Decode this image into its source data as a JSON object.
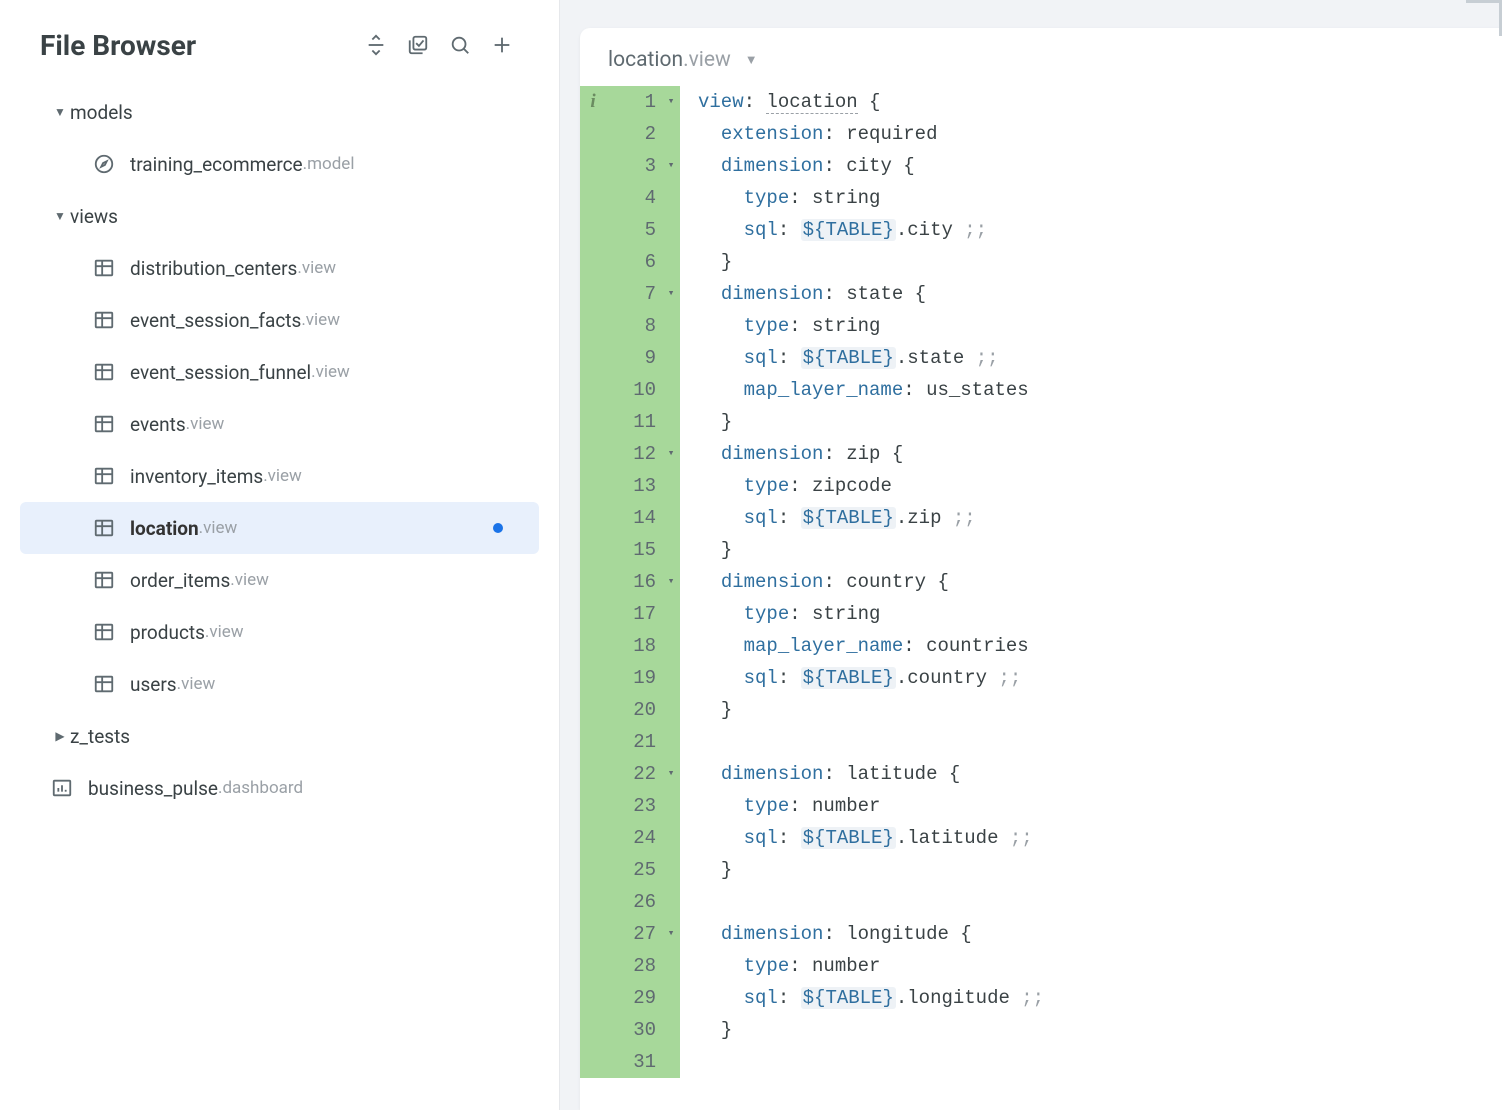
{
  "sidebar": {
    "title": "File Browser",
    "folders": {
      "models": {
        "label": "models",
        "expanded": true
      },
      "views": {
        "label": "views",
        "expanded": true
      },
      "ztests": {
        "label": "z_tests",
        "expanded": false
      }
    },
    "model_files": [
      {
        "name": "training_ecommerce",
        "ext": ".model"
      }
    ],
    "view_files": [
      {
        "name": "distribution_centers",
        "ext": ".view"
      },
      {
        "name": "event_session_facts",
        "ext": ".view"
      },
      {
        "name": "event_session_funnel",
        "ext": ".view"
      },
      {
        "name": "events",
        "ext": ".view"
      },
      {
        "name": "inventory_items",
        "ext": ".view"
      },
      {
        "name": "location",
        "ext": ".view",
        "selected": true,
        "dirty": true
      },
      {
        "name": "order_items",
        "ext": ".view"
      },
      {
        "name": "products",
        "ext": ".view"
      },
      {
        "name": "users",
        "ext": ".view"
      }
    ],
    "root_files": [
      {
        "name": "business_pulse",
        "ext": ".dashboard"
      }
    ]
  },
  "editor": {
    "tab": {
      "name": "location",
      "ext": ".view"
    },
    "lines": [
      {
        "n": 1,
        "info": "i",
        "fold": "▾",
        "tokens": [
          [
            "kw",
            "view"
          ],
          [
            "punct",
            ": "
          ],
          [
            "id underlined",
            "location"
          ],
          [
            "punct",
            " "
          ],
          [
            "brace",
            "{"
          ]
        ]
      },
      {
        "n": 2,
        "tokens": [
          [
            "pad",
            "  "
          ],
          [
            "kw",
            "extension"
          ],
          [
            "punct",
            ": "
          ],
          [
            "str",
            "required"
          ]
        ]
      },
      {
        "n": 3,
        "fold": "▾",
        "tokens": [
          [
            "pad",
            "  "
          ],
          [
            "kw",
            "dimension"
          ],
          [
            "punct",
            ": "
          ],
          [
            "str",
            "city "
          ],
          [
            "brace",
            "{"
          ]
        ]
      },
      {
        "n": 4,
        "tokens": [
          [
            "pad",
            "    "
          ],
          [
            "typ",
            "type"
          ],
          [
            "punct",
            ": "
          ],
          [
            "str",
            "string"
          ]
        ]
      },
      {
        "n": 5,
        "tokens": [
          [
            "pad",
            "    "
          ],
          [
            "typ",
            "sql"
          ],
          [
            "punct",
            ": "
          ],
          [
            "mac",
            "${TABLE}"
          ],
          [
            "str",
            ".city "
          ],
          [
            "semi",
            ";;"
          ]
        ]
      },
      {
        "n": 6,
        "tokens": [
          [
            "pad",
            "  "
          ],
          [
            "brace",
            "}"
          ]
        ]
      },
      {
        "n": 7,
        "fold": "▾",
        "tokens": [
          [
            "pad",
            "  "
          ],
          [
            "kw",
            "dimension"
          ],
          [
            "punct",
            ": "
          ],
          [
            "str",
            "state "
          ],
          [
            "brace",
            "{"
          ]
        ]
      },
      {
        "n": 8,
        "tokens": [
          [
            "pad",
            "    "
          ],
          [
            "typ",
            "type"
          ],
          [
            "punct",
            ": "
          ],
          [
            "str",
            "string"
          ]
        ]
      },
      {
        "n": 9,
        "tokens": [
          [
            "pad",
            "    "
          ],
          [
            "typ",
            "sql"
          ],
          [
            "punct",
            ": "
          ],
          [
            "mac",
            "${TABLE}"
          ],
          [
            "str",
            ".state "
          ],
          [
            "semi",
            ";;"
          ]
        ]
      },
      {
        "n": 10,
        "tokens": [
          [
            "pad",
            "    "
          ],
          [
            "kw",
            "map_layer_name"
          ],
          [
            "punct",
            ": "
          ],
          [
            "str",
            "us_states"
          ]
        ]
      },
      {
        "n": 11,
        "tokens": [
          [
            "pad",
            "  "
          ],
          [
            "brace",
            "}"
          ]
        ]
      },
      {
        "n": 12,
        "fold": "▾",
        "tokens": [
          [
            "pad",
            "  "
          ],
          [
            "kw",
            "dimension"
          ],
          [
            "punct",
            ": "
          ],
          [
            "str",
            "zip "
          ],
          [
            "brace",
            "{"
          ]
        ]
      },
      {
        "n": 13,
        "tokens": [
          [
            "pad",
            "    "
          ],
          [
            "typ",
            "type"
          ],
          [
            "punct",
            ": "
          ],
          [
            "str",
            "zipcode"
          ]
        ]
      },
      {
        "n": 14,
        "tokens": [
          [
            "pad",
            "    "
          ],
          [
            "typ",
            "sql"
          ],
          [
            "punct",
            ": "
          ],
          [
            "mac",
            "${TABLE}"
          ],
          [
            "str",
            ".zip "
          ],
          [
            "semi",
            ";;"
          ]
        ]
      },
      {
        "n": 15,
        "tokens": [
          [
            "pad",
            "  "
          ],
          [
            "brace",
            "}"
          ]
        ]
      },
      {
        "n": 16,
        "fold": "▾",
        "tokens": [
          [
            "pad",
            "  "
          ],
          [
            "kw",
            "dimension"
          ],
          [
            "punct",
            ": "
          ],
          [
            "str",
            "country "
          ],
          [
            "brace",
            "{"
          ]
        ]
      },
      {
        "n": 17,
        "tokens": [
          [
            "pad",
            "    "
          ],
          [
            "typ",
            "type"
          ],
          [
            "punct",
            ": "
          ],
          [
            "str",
            "string"
          ]
        ]
      },
      {
        "n": 18,
        "tokens": [
          [
            "pad",
            "    "
          ],
          [
            "kw",
            "map_layer_name"
          ],
          [
            "punct",
            ": "
          ],
          [
            "str",
            "countries"
          ]
        ]
      },
      {
        "n": 19,
        "tokens": [
          [
            "pad",
            "    "
          ],
          [
            "typ",
            "sql"
          ],
          [
            "punct",
            ": "
          ],
          [
            "mac",
            "${TABLE}"
          ],
          [
            "str",
            ".country "
          ],
          [
            "semi",
            ";;"
          ]
        ]
      },
      {
        "n": 20,
        "tokens": [
          [
            "pad",
            "  "
          ],
          [
            "brace",
            "}"
          ]
        ]
      },
      {
        "n": 21,
        "tokens": [
          [
            "pad",
            ""
          ]
        ]
      },
      {
        "n": 22,
        "fold": "▾",
        "tokens": [
          [
            "pad",
            "  "
          ],
          [
            "kw",
            "dimension"
          ],
          [
            "punct",
            ": "
          ],
          [
            "str",
            "latitude "
          ],
          [
            "brace",
            "{"
          ]
        ]
      },
      {
        "n": 23,
        "tokens": [
          [
            "pad",
            "    "
          ],
          [
            "typ",
            "type"
          ],
          [
            "punct",
            ": "
          ],
          [
            "str",
            "number"
          ]
        ]
      },
      {
        "n": 24,
        "tokens": [
          [
            "pad",
            "    "
          ],
          [
            "typ",
            "sql"
          ],
          [
            "punct",
            ": "
          ],
          [
            "mac",
            "${TABLE}"
          ],
          [
            "str",
            ".latitude "
          ],
          [
            "semi",
            ";;"
          ]
        ]
      },
      {
        "n": 25,
        "tokens": [
          [
            "pad",
            "  "
          ],
          [
            "brace",
            "}"
          ]
        ]
      },
      {
        "n": 26,
        "tokens": [
          [
            "pad",
            ""
          ]
        ]
      },
      {
        "n": 27,
        "fold": "▾",
        "tokens": [
          [
            "pad",
            "  "
          ],
          [
            "kw",
            "dimension"
          ],
          [
            "punct",
            ": "
          ],
          [
            "str",
            "longitude "
          ],
          [
            "brace",
            "{"
          ]
        ]
      },
      {
        "n": 28,
        "tokens": [
          [
            "pad",
            "    "
          ],
          [
            "typ",
            "type"
          ],
          [
            "punct",
            ": "
          ],
          [
            "str",
            "number"
          ]
        ]
      },
      {
        "n": 29,
        "tokens": [
          [
            "pad",
            "    "
          ],
          [
            "typ",
            "sql"
          ],
          [
            "punct",
            ": "
          ],
          [
            "mac",
            "${TABLE}"
          ],
          [
            "str",
            ".longitude "
          ],
          [
            "semi",
            ";;"
          ]
        ]
      },
      {
        "n": 30,
        "tokens": [
          [
            "pad",
            "  "
          ],
          [
            "brace",
            "}"
          ]
        ]
      },
      {
        "n": 31,
        "tokens": [
          [
            "pad",
            ""
          ]
        ]
      }
    ]
  }
}
